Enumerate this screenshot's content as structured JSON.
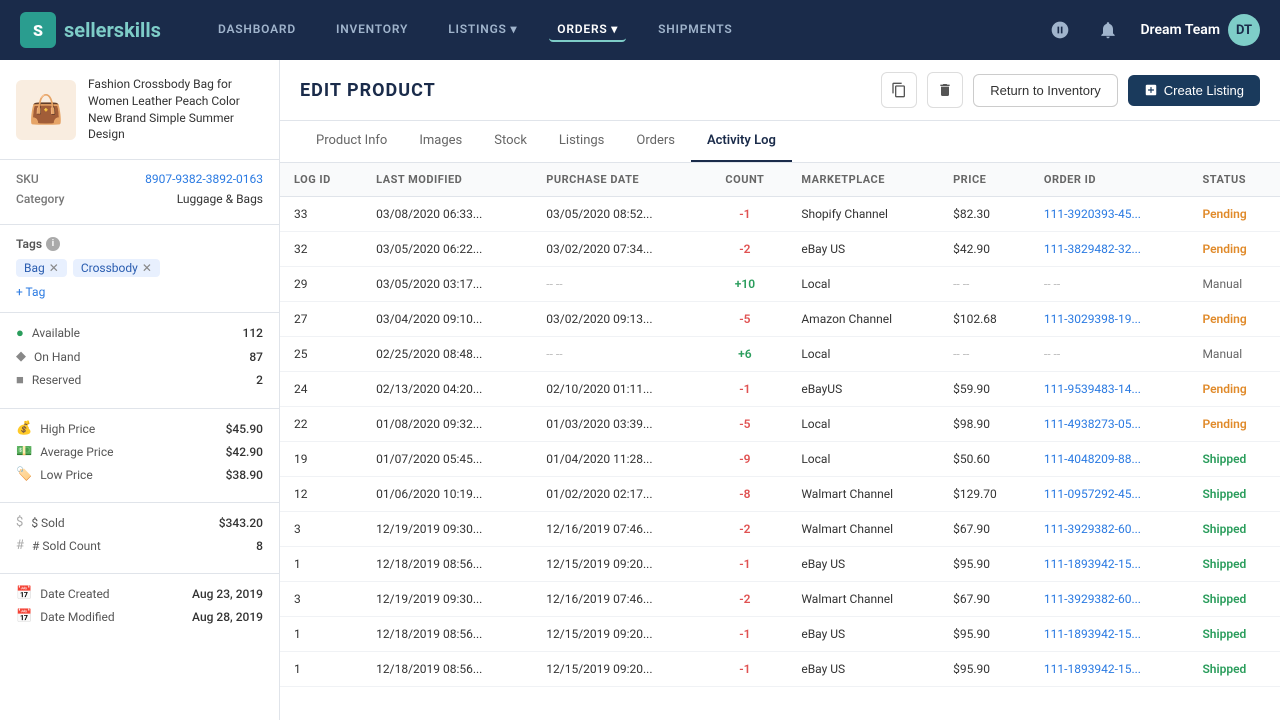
{
  "nav": {
    "logo_text_main": "seller",
    "logo_text_accent": "skills",
    "links": [
      {
        "label": "DASHBOARD",
        "active": false
      },
      {
        "label": "INVENTORY",
        "active": false
      },
      {
        "label": "LISTINGS",
        "active": false,
        "arrow": true
      },
      {
        "label": "ORDERS",
        "active": true,
        "arrow": true
      },
      {
        "label": "SHIPMENTS",
        "active": false
      }
    ],
    "user_name": "Dream Team",
    "user_initials": "DT"
  },
  "sidebar": {
    "product_emoji": "👜",
    "product_title": "Fashion Crossbody Bag for Women Leather Peach Color New Brand Simple Summer Design",
    "sku_label": "SKU",
    "sku_value": "8907-9382-3892-0163",
    "category_label": "Category",
    "category_value": "Luggage & Bags",
    "tags_label": "Tags",
    "tags": [
      {
        "label": "Bag"
      },
      {
        "label": "Crossbody"
      }
    ],
    "add_tag_label": "+ Tag",
    "stats": [
      {
        "icon": "●",
        "label": "Available",
        "value": "112"
      },
      {
        "icon": "◆",
        "label": "On Hand",
        "value": "87"
      },
      {
        "icon": "■",
        "label": "Reserved",
        "value": "2"
      }
    ],
    "prices": [
      {
        "label": "High Price",
        "value": "$45.90"
      },
      {
        "label": "Average Price",
        "value": "$42.90"
      },
      {
        "label": "Low Price",
        "value": "$38.90"
      }
    ],
    "sold": [
      {
        "label": "$ Sold",
        "value": "$343.20"
      },
      {
        "label": "# Sold Count",
        "value": "8"
      }
    ],
    "dates": [
      {
        "label": "Date Created",
        "value": "Aug 23, 2019"
      },
      {
        "label": "Date Modified",
        "value": "Aug 28, 2019"
      }
    ]
  },
  "header": {
    "title": "EDIT PRODUCT",
    "return_label": "Return to Inventory",
    "create_label": "Create Listing"
  },
  "tabs": [
    {
      "label": "Product Info",
      "active": false
    },
    {
      "label": "Images",
      "active": false
    },
    {
      "label": "Stock",
      "active": false
    },
    {
      "label": "Listings",
      "active": false
    },
    {
      "label": "Orders",
      "active": false
    },
    {
      "label": "Activity Log",
      "active": true
    }
  ],
  "table": {
    "columns": [
      "LOG ID",
      "LAST MODIFIED",
      "PURCHASE DATE",
      "COUNT",
      "MARKETPLACE",
      "PRICE",
      "ORDER ID",
      "STATUS"
    ],
    "rows": [
      {
        "log_id": "33",
        "last_modified": "03/08/2020 06:33...",
        "purchase_date": "03/05/2020 08:52...",
        "count": "-1",
        "count_type": "neg",
        "marketplace": "Shopify Channel",
        "price": "$82.30",
        "order_id": "111-3920393-45...",
        "order_link": true,
        "status": "Pending",
        "status_type": "pending"
      },
      {
        "log_id": "32",
        "last_modified": "03/05/2020 06:22...",
        "purchase_date": "03/02/2020 07:34...",
        "count": "-2",
        "count_type": "neg",
        "marketplace": "eBay US",
        "price": "$42.90",
        "order_id": "111-3829482-32...",
        "order_link": true,
        "status": "Pending",
        "status_type": "pending"
      },
      {
        "log_id": "29",
        "last_modified": "03/05/2020 03:17...",
        "purchase_date": "-- --",
        "count": "+10",
        "count_type": "pos",
        "marketplace": "Local",
        "price": "-- --",
        "order_id": "-- --",
        "order_link": false,
        "status": "Manual",
        "status_type": "manual"
      },
      {
        "log_id": "27",
        "last_modified": "03/04/2020 09:10...",
        "purchase_date": "03/02/2020 09:13...",
        "count": "-5",
        "count_type": "neg",
        "marketplace": "Amazon Channel",
        "price": "$102.68",
        "order_id": "111-3029398-19...",
        "order_link": true,
        "status": "Pending",
        "status_type": "pending"
      },
      {
        "log_id": "25",
        "last_modified": "02/25/2020 08:48...",
        "purchase_date": "-- --",
        "count": "+6",
        "count_type": "pos",
        "marketplace": "Local",
        "price": "-- --",
        "order_id": "-- --",
        "order_link": false,
        "status": "Manual",
        "status_type": "manual"
      },
      {
        "log_id": "24",
        "last_modified": "02/13/2020 04:20...",
        "purchase_date": "02/10/2020 01:11...",
        "count": "-1",
        "count_type": "neg",
        "marketplace": "eBayUS",
        "price": "$59.90",
        "order_id": "111-9539483-14...",
        "order_link": true,
        "status": "Pending",
        "status_type": "pending"
      },
      {
        "log_id": "22",
        "last_modified": "01/08/2020 09:32...",
        "purchase_date": "01/03/2020 03:39...",
        "count": "-5",
        "count_type": "neg",
        "marketplace": "Local",
        "price": "$98.90",
        "order_id": "111-4938273-05...",
        "order_link": true,
        "status": "Pending",
        "status_type": "pending"
      },
      {
        "log_id": "19",
        "last_modified": "01/07/2020 05:45...",
        "purchase_date": "01/04/2020 11:28...",
        "count": "-9",
        "count_type": "neg",
        "marketplace": "Local",
        "price": "$50.60",
        "order_id": "111-4048209-88...",
        "order_link": true,
        "status": "Shipped",
        "status_type": "shipped"
      },
      {
        "log_id": "12",
        "last_modified": "01/06/2020 10:19...",
        "purchase_date": "01/02/2020 02:17...",
        "count": "-8",
        "count_type": "neg",
        "marketplace": "Walmart Channel",
        "price": "$129.70",
        "order_id": "111-0957292-45...",
        "order_link": true,
        "status": "Shipped",
        "status_type": "shipped"
      },
      {
        "log_id": "3",
        "last_modified": "12/19/2019 09:30...",
        "purchase_date": "12/16/2019 07:46...",
        "count": "-2",
        "count_type": "neg",
        "marketplace": "Walmart Channel",
        "price": "$67.90",
        "order_id": "111-3929382-60...",
        "order_link": true,
        "status": "Shipped",
        "status_type": "shipped"
      },
      {
        "log_id": "1",
        "last_modified": "12/18/2019 08:56...",
        "purchase_date": "12/15/2019 09:20...",
        "count": "-1",
        "count_type": "neg",
        "marketplace": "eBay US",
        "price": "$95.90",
        "order_id": "111-1893942-15...",
        "order_link": true,
        "status": "Shipped",
        "status_type": "shipped"
      },
      {
        "log_id": "3",
        "last_modified": "12/19/2019 09:30...",
        "purchase_date": "12/16/2019 07:46...",
        "count": "-2",
        "count_type": "neg",
        "marketplace": "Walmart Channel",
        "price": "$67.90",
        "order_id": "111-3929382-60...",
        "order_link": true,
        "status": "Shipped",
        "status_type": "shipped"
      },
      {
        "log_id": "1",
        "last_modified": "12/18/2019 08:56...",
        "purchase_date": "12/15/2019 09:20...",
        "count": "-1",
        "count_type": "neg",
        "marketplace": "eBay US",
        "price": "$95.90",
        "order_id": "111-1893942-15...",
        "order_link": true,
        "status": "Shipped",
        "status_type": "shipped"
      },
      {
        "log_id": "1",
        "last_modified": "12/18/2019 08:56...",
        "purchase_date": "12/15/2019 09:20...",
        "count": "-1",
        "count_type": "neg",
        "marketplace": "eBay US",
        "price": "$95.90",
        "order_id": "111-1893942-15...",
        "order_link": true,
        "status": "Shipped",
        "status_type": "shipped"
      }
    ]
  }
}
